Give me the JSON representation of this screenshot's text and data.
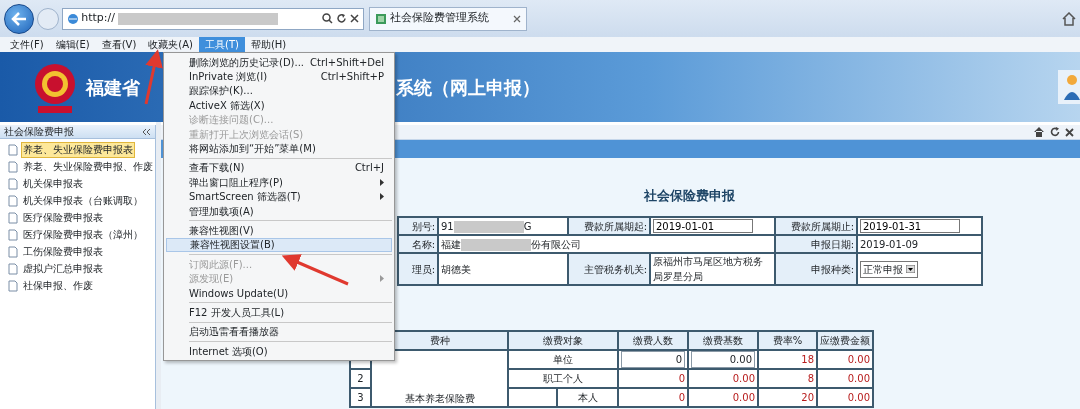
{
  "browser": {
    "address": "http://",
    "tab_title": "社会保险费管理系统"
  },
  "menu_bar": [
    {
      "label": "文件(F)",
      "selected": false
    },
    {
      "label": "编辑(E)",
      "selected": false
    },
    {
      "label": "查看(V)",
      "selected": false
    },
    {
      "label": "收藏夹(A)",
      "selected": false
    },
    {
      "label": "工具(T)",
      "selected": true
    },
    {
      "label": "帮助(H)",
      "selected": false
    }
  ],
  "tools_menu": [
    {
      "kind": "item",
      "label": "删除浏览的历史记录(D)...",
      "shortcut": "Ctrl+Shift+Del",
      "disabled": false,
      "submenu": false,
      "selected": false
    },
    {
      "kind": "item",
      "label": "InPrivate 浏览(I)",
      "shortcut": "Ctrl+Shift+P",
      "disabled": false,
      "submenu": false,
      "selected": false
    },
    {
      "kind": "item",
      "label": "跟踪保护(K)...",
      "disabled": false,
      "submenu": false,
      "selected": false
    },
    {
      "kind": "item",
      "label": "ActiveX 筛选(X)",
      "disabled": false,
      "submenu": false,
      "selected": false
    },
    {
      "kind": "item",
      "label": "诊断连接问题(C)...",
      "disabled": true,
      "submenu": false,
      "selected": false
    },
    {
      "kind": "item",
      "label": "重新打开上次浏览会话(S)",
      "disabled": true,
      "submenu": false,
      "selected": false
    },
    {
      "kind": "item",
      "label": "将网站添加到“开始”菜单(M)",
      "disabled": false,
      "submenu": false,
      "selected": false
    },
    {
      "kind": "separator"
    },
    {
      "kind": "item",
      "label": "查看下载(N)",
      "shortcut": "Ctrl+J",
      "disabled": false,
      "submenu": false,
      "selected": false
    },
    {
      "kind": "item",
      "label": "弹出窗口阻止程序(P)",
      "disabled": false,
      "submenu": true,
      "selected": false
    },
    {
      "kind": "item",
      "label": "SmartScreen 筛选器(T)",
      "disabled": false,
      "submenu": true,
      "selected": false
    },
    {
      "kind": "item",
      "label": "管理加载项(A)",
      "disabled": false,
      "submenu": false,
      "selected": false
    },
    {
      "kind": "separator"
    },
    {
      "kind": "item",
      "label": "兼容性视图(V)",
      "disabled": false,
      "submenu": false,
      "selected": false
    },
    {
      "kind": "item",
      "label": "兼容性视图设置(B)",
      "disabled": false,
      "submenu": false,
      "selected": true
    },
    {
      "kind": "separator"
    },
    {
      "kind": "item",
      "label": "订阅此源(F)...",
      "disabled": true,
      "submenu": false,
      "selected": false
    },
    {
      "kind": "item",
      "label": "源发现(E)",
      "disabled": true,
      "submenu": true,
      "selected": false
    },
    {
      "kind": "item",
      "label": "Windows Update(U)",
      "disabled": false,
      "submenu": false,
      "selected": false
    },
    {
      "kind": "separator"
    },
    {
      "kind": "item",
      "label": "F12 开发人员工具(L)",
      "disabled": false,
      "submenu": false,
      "selected": false
    },
    {
      "kind": "separator"
    },
    {
      "kind": "item",
      "label": "启动迅雷看看播放器",
      "disabled": false,
      "submenu": false,
      "selected": false
    },
    {
      "kind": "separator"
    },
    {
      "kind": "item",
      "label": "Internet 选项(O)",
      "disabled": false,
      "submenu": false,
      "selected": false
    }
  ],
  "banner": {
    "title_start": "福建省",
    "title_end": "系统（网上申报）"
  },
  "sidebar": {
    "title": "社会保险费申报",
    "items": [
      {
        "label": "养老、失业保险费申报表",
        "selected": true
      },
      {
        "label": "养老、失业保险费申报、作废",
        "selected": false
      },
      {
        "label": "机关保申报表",
        "selected": false
      },
      {
        "label": "机关保申报表（台账调取）",
        "selected": false
      },
      {
        "label": "医疗保险费申报表",
        "selected": false
      },
      {
        "label": "医疗保险费申报表（漳州）",
        "selected": false
      },
      {
        "label": "工伤保险费申报表",
        "selected": false
      },
      {
        "label": "虚拟户汇总申报表",
        "selected": false
      },
      {
        "label": "社保申报、作废",
        "selected": false
      }
    ]
  },
  "form": {
    "title": "社会保险费申报",
    "rows": [
      [
        {
          "kind": "label",
          "text": "别号:"
        },
        {
          "kind": "masked",
          "before": "91",
          "after": "G"
        },
        {
          "kind": "label",
          "text": "费款所属期起:"
        },
        {
          "kind": "input",
          "value": "2019-01-01"
        },
        {
          "kind": "label",
          "text": "费款所属期止:"
        },
        {
          "kind": "input",
          "value": "2019-01-31"
        }
      ],
      [
        {
          "kind": "label",
          "text": "名称:"
        },
        {
          "kind": "masked",
          "before": "福建",
          "after": "份有限公司",
          "colspan": 3
        },
        {
          "kind": "label",
          "text": "申报日期:"
        },
        {
          "kind": "text",
          "text": "2019-01-09"
        }
      ],
      [
        {
          "kind": "label",
          "text": "理员:"
        },
        {
          "kind": "text",
          "text": "胡德美"
        },
        {
          "kind": "label",
          "text": "主管税务机关:"
        },
        {
          "kind": "text",
          "text": "原福州市马尾区地方税务局罗星分局"
        },
        {
          "kind": "label",
          "text": "申报种类:"
        },
        {
          "kind": "select",
          "value": "正常申报"
        }
      ]
    ]
  },
  "table": {
    "columns": [
      "费种",
      "缴费对象",
      "缴费人数",
      "缴费基数",
      "费率%",
      "应缴费金额"
    ],
    "fee_type": "基本养老保险费",
    "rows": [
      {
        "object": "单位",
        "sub": false,
        "count": {
          "value": "0",
          "editable": true
        },
        "base": {
          "value": "0.00",
          "editable": true
        },
        "rate": {
          "value": "18",
          "editable": false
        },
        "amount": {
          "value": "0.00",
          "editable": false
        }
      },
      {
        "number": "2",
        "object": "职工个人",
        "sub": false,
        "count": {
          "value": "0",
          "editable": false
        },
        "base": {
          "value": "0.00",
          "editable": false
        },
        "rate": {
          "value": "8",
          "editable": false
        },
        "amount": {
          "value": "0.00",
          "editable": false
        }
      },
      {
        "number": "3",
        "object": "本人",
        "sub": true,
        "count": {
          "value": "0",
          "editable": false
        },
        "base": {
          "value": "0.00",
          "editable": false
        },
        "rate": {
          "value": "20",
          "editable": false
        },
        "amount": {
          "value": "0.00",
          "editable": false
        }
      }
    ]
  }
}
